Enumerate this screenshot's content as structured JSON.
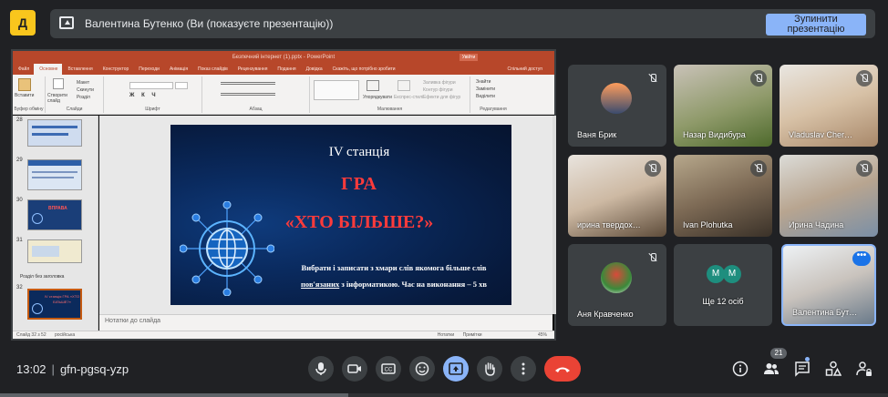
{
  "topbar": {
    "logo_text": "Д",
    "presenter_text": "Валентина Бутенко (Ви (показуєте презентацію))",
    "stop_button": "Зупинити презентацію"
  },
  "ppt": {
    "title": "Безпечний інтернет (1).pptx  -  PowerPoint",
    "share": "Увійти",
    "tabs": [
      "Файл",
      "Основне",
      "Вставлення",
      "Конструктор",
      "Переходи",
      "Анімація",
      "Показ слайдів",
      "Рецензування",
      "Подання",
      "Довідка",
      "Скажіть, що потрібно зробити",
      "Спільний доступ"
    ],
    "ribbon_groups": [
      "Буфер обміну",
      "Слайди",
      "Шрифт",
      "Абзац",
      "Малювання",
      "Редагування"
    ],
    "ribbon_items": {
      "paste": "Вставити",
      "new_slide": "Створити слайд",
      "layout": "Макет",
      "reset": "Скинути",
      "section": "Розділ",
      "arrange": "Упорядкувати",
      "styles": "Експрес-стилі",
      "find": "Знайти",
      "replace": "Замінити",
      "select": "Виділити",
      "shape_fill": "Заливка фігури",
      "shape_outline": "Контур фігури",
      "shape_effects": "Ефекти для фігур"
    },
    "thumb_numbers": [
      "28",
      "29",
      "30",
      "31",
      "32"
    ],
    "section_label": "Розділ без заголовка",
    "thumb30_text": "ВПРАВА",
    "thumb32_text": "IV станція ГРА «ХТО БІЛЬШЕ?»",
    "notes": "Нотатки до слайда",
    "status_left": "Слайд 32 з 52",
    "status_lang": "російська",
    "status_notes": "Нотатки",
    "status_comments": "Примітки",
    "zoom": "45%"
  },
  "slide": {
    "station": "IV станція",
    "game": "ГРА",
    "game_name": "«ХТО БІЛЬШЕ?»",
    "task_line1": "Вибрати і записати з хмари слів якомога більше слів",
    "task_line2_underlined": "пов'язаних",
    "task_line2_rest": " з інформатикою. Час на виконання – 5 хв"
  },
  "participants": [
    {
      "name": "Ваня Брик",
      "muted": true
    },
    {
      "name": "Назар Видибура",
      "muted": true
    },
    {
      "name": "Vladuslav Cher…",
      "muted": true
    },
    {
      "name": "ирина твердох…",
      "muted": true
    },
    {
      "name": "Ivan Plohutka",
      "muted": true
    },
    {
      "name": "Ирина Чадина",
      "muted": true
    },
    {
      "name": "Аня Кравченко",
      "muted": true
    },
    {
      "name": "Ще 12 осіб",
      "muted": false
    },
    {
      "name": "Валентина Бут…",
      "muted": false
    }
  ],
  "more_avatars": [
    "M",
    "M"
  ],
  "more_dots": "•••",
  "bottom": {
    "time": "13:02",
    "meeting_code": "gfn-pgsq-yzp",
    "participants_count": "21"
  },
  "colors": {
    "accent_blue": "#8ab4f8",
    "end_call": "#ea4335",
    "ppt_red": "#b7472a",
    "slide_red": "#ff3b3b"
  }
}
